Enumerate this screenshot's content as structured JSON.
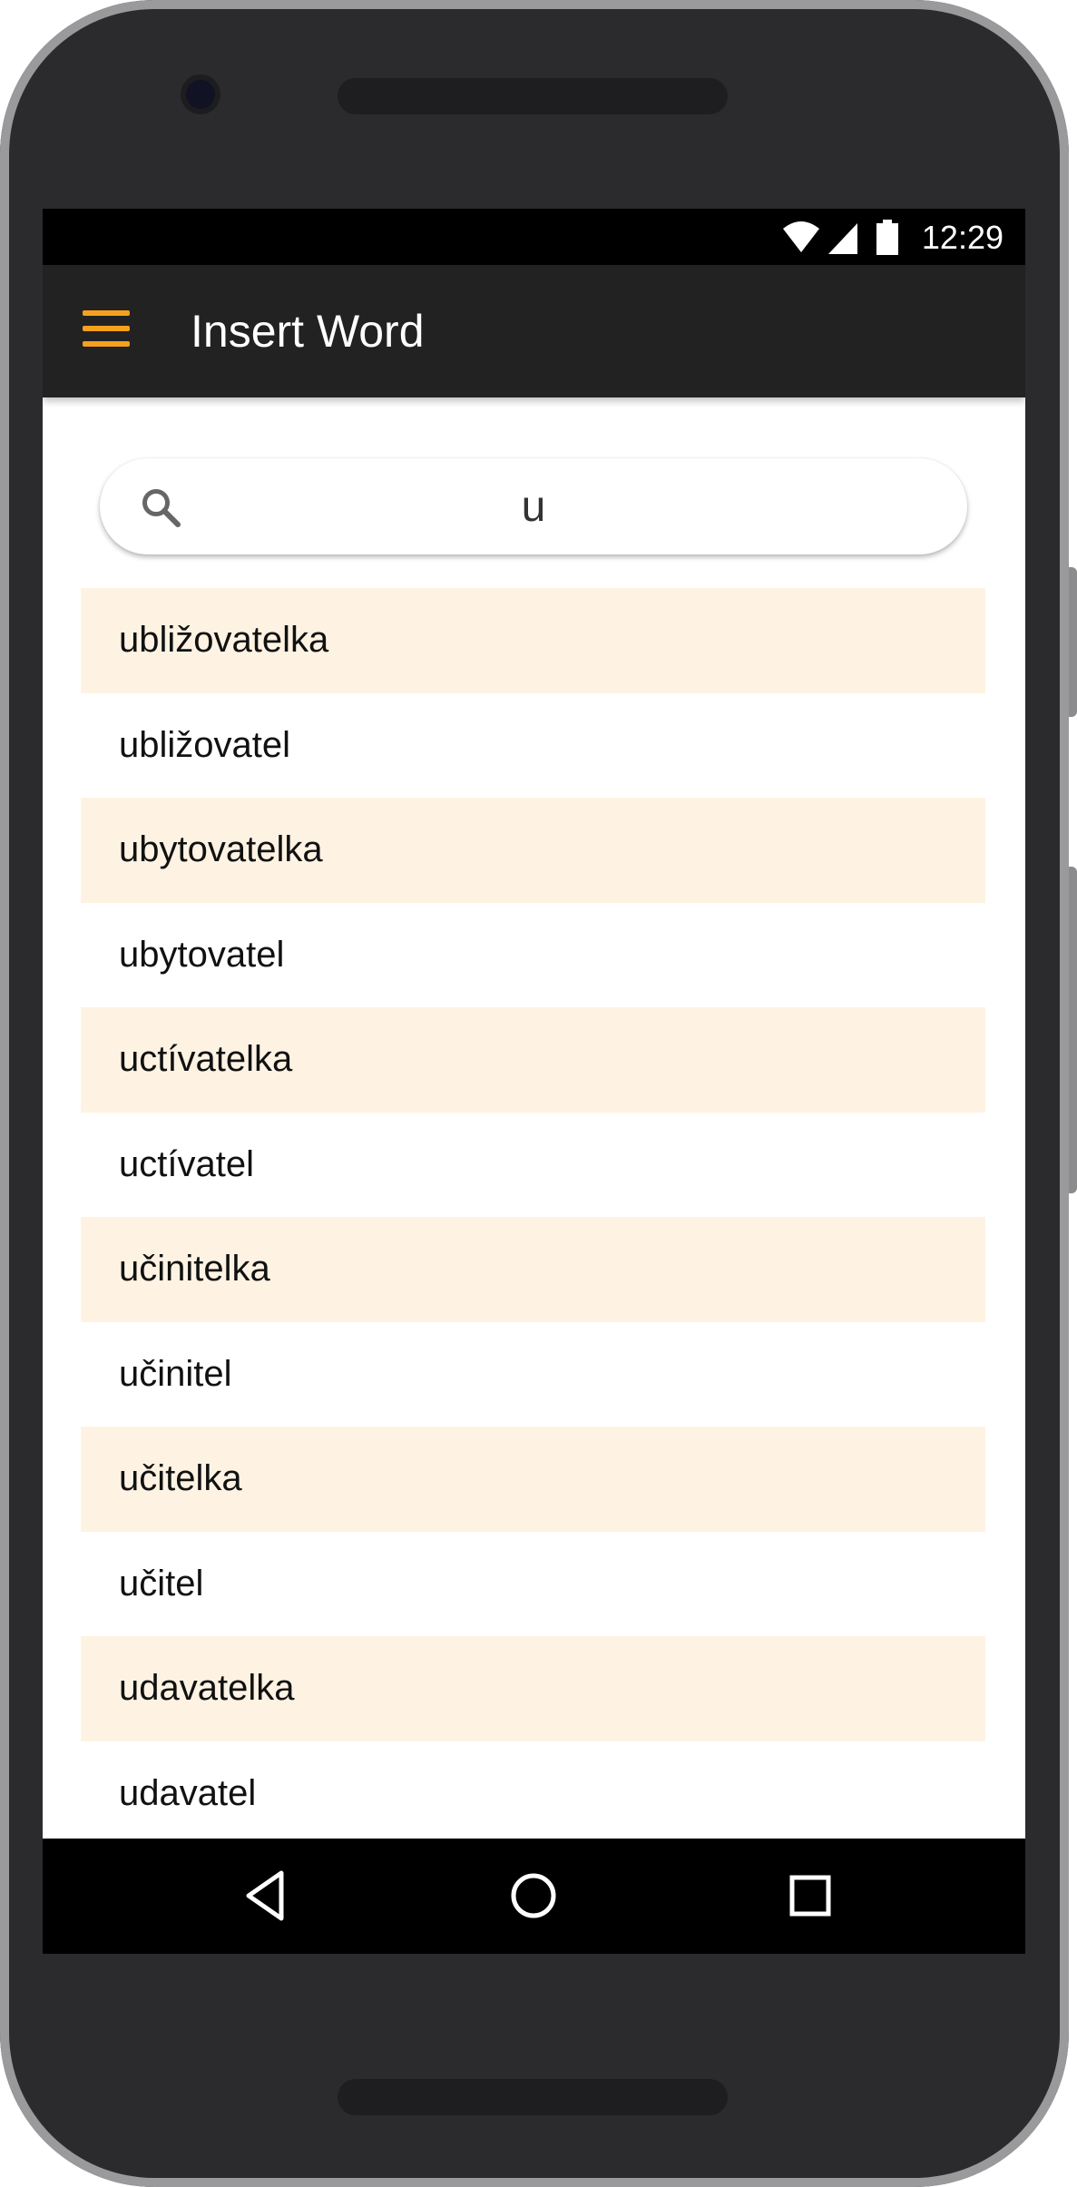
{
  "status_bar": {
    "time": "12:29",
    "icons": [
      "wifi-icon",
      "cell-signal-icon",
      "battery-icon"
    ]
  },
  "app_bar": {
    "title": "Insert Word",
    "menu_icon": "hamburger-menu-icon",
    "menu_color": "#f5a11d"
  },
  "search": {
    "icon": "search-icon",
    "value": "u"
  },
  "words": [
    {
      "label": "ubližovatelka"
    },
    {
      "label": "ubližovatel"
    },
    {
      "label": "ubytovatelka"
    },
    {
      "label": "ubytovatel"
    },
    {
      "label": "uctívatelka"
    },
    {
      "label": "uctívatel"
    },
    {
      "label": "učinitelka"
    },
    {
      "label": "učinitel"
    },
    {
      "label": "učitelka"
    },
    {
      "label": "učitel"
    },
    {
      "label": "udavatelka"
    },
    {
      "label": "udavatel"
    }
  ],
  "colors": {
    "highlight_row": "#fef3e3",
    "app_bar_bg": "#222222"
  },
  "nav_bar": {
    "buttons": [
      "back-icon",
      "home-icon",
      "recents-icon"
    ]
  }
}
